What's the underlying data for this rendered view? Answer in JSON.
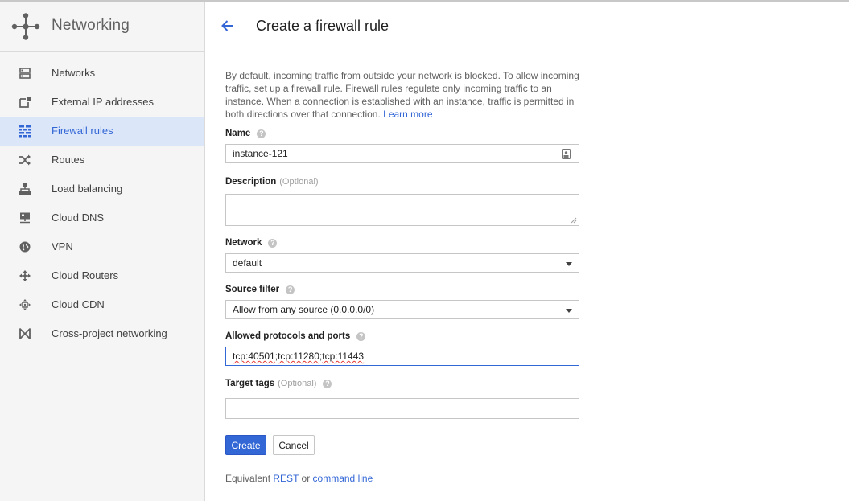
{
  "app": {
    "title": "Networking",
    "logo_icon": "networking-logo-icon"
  },
  "sidebar": {
    "items": [
      {
        "label": "Networks",
        "icon": "networks-icon",
        "active": false
      },
      {
        "label": "External IP addresses",
        "icon": "external-ip-icon",
        "active": false
      },
      {
        "label": "Firewall rules",
        "icon": "firewall-icon",
        "active": true
      },
      {
        "label": "Routes",
        "icon": "routes-icon",
        "active": false
      },
      {
        "label": "Load balancing",
        "icon": "load-balancing-icon",
        "active": false
      },
      {
        "label": "Cloud DNS",
        "icon": "cloud-dns-icon",
        "active": false
      },
      {
        "label": "VPN",
        "icon": "vpn-icon",
        "active": false
      },
      {
        "label": "Cloud Routers",
        "icon": "cloud-routers-icon",
        "active": false
      },
      {
        "label": "Cloud CDN",
        "icon": "cloud-cdn-icon",
        "active": false
      },
      {
        "label": "Cross-project networking",
        "icon": "cross-project-icon",
        "active": false
      }
    ]
  },
  "header": {
    "title": "Create a firewall rule",
    "back_icon": "back-arrow-icon"
  },
  "form": {
    "intro": "By default, incoming traffic from outside your network is blocked. To allow incoming traffic, set up a firewall rule. Firewall rules regulate only incoming traffic to an instance. When a connection is established with an instance, traffic is permitted in both directions over that connection.",
    "learn_more": "Learn more",
    "name": {
      "label": "Name",
      "value": "instance-121"
    },
    "description": {
      "label": "Description",
      "optional": "(Optional)",
      "value": ""
    },
    "network": {
      "label": "Network",
      "value": "default"
    },
    "source_filter": {
      "label": "Source filter",
      "value": "Allow from any source (0.0.0.0/0)"
    },
    "protocols": {
      "label": "Allowed protocols and ports",
      "parts": [
        "tcp:40501",
        "; ",
        "tcp:11280",
        "; ",
        "tcp:11443"
      ]
    },
    "target_tags": {
      "label": "Target tags",
      "optional": "(Optional)",
      "value": ""
    },
    "help_glyph": "?"
  },
  "buttons": {
    "create": "Create",
    "cancel": "Cancel"
  },
  "footer": {
    "prefix": "Equivalent",
    "rest": "REST",
    "or": "or",
    "command_line": "command line"
  },
  "colors": {
    "accent": "#3367d6",
    "active_bg": "#dbe6f8"
  }
}
